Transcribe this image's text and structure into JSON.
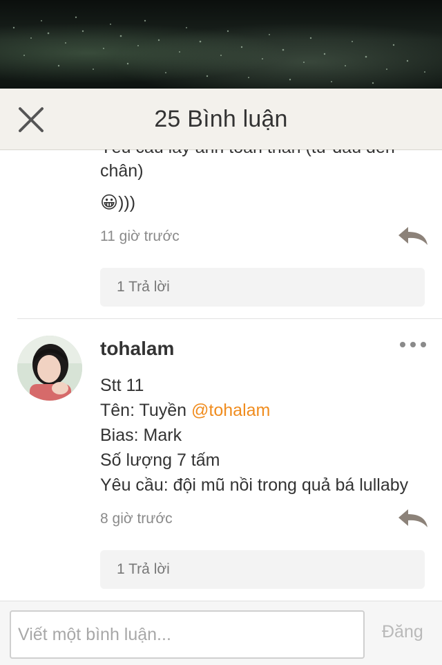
{
  "header": {
    "title": "25 Bình luận"
  },
  "comments": [
    {
      "lines": [
        "Yêu cầu lấy ảnh toàn thân (từ đầu đến",
        "chân)",
        ")))"
      ],
      "emoji": "😀",
      "time": "11 giờ trước",
      "reply_label": "1 Trả lời"
    },
    {
      "username": "tohalam",
      "lines": [
        "Stt 11",
        "Tên: Tuyền ",
        "Bias: Mark",
        "Số lượng 7 tấm",
        "Yêu cầu: đội mũ nồi trong quả bá lullaby"
      ],
      "mention": "@tohalam",
      "time": "8 giờ trước",
      "reply_label": "1 Trả lời"
    }
  ],
  "footer": {
    "input_placeholder": "Viết một bình luận...",
    "post_label": "Đăng"
  },
  "colors": {
    "mention": "#f08c1e",
    "header_bg": "#f3f1ec",
    "reply_icon": "#8c8279"
  },
  "icons": {
    "close": "close-icon",
    "reply": "reply-arrow-icon",
    "more": "more-dots-icon"
  }
}
